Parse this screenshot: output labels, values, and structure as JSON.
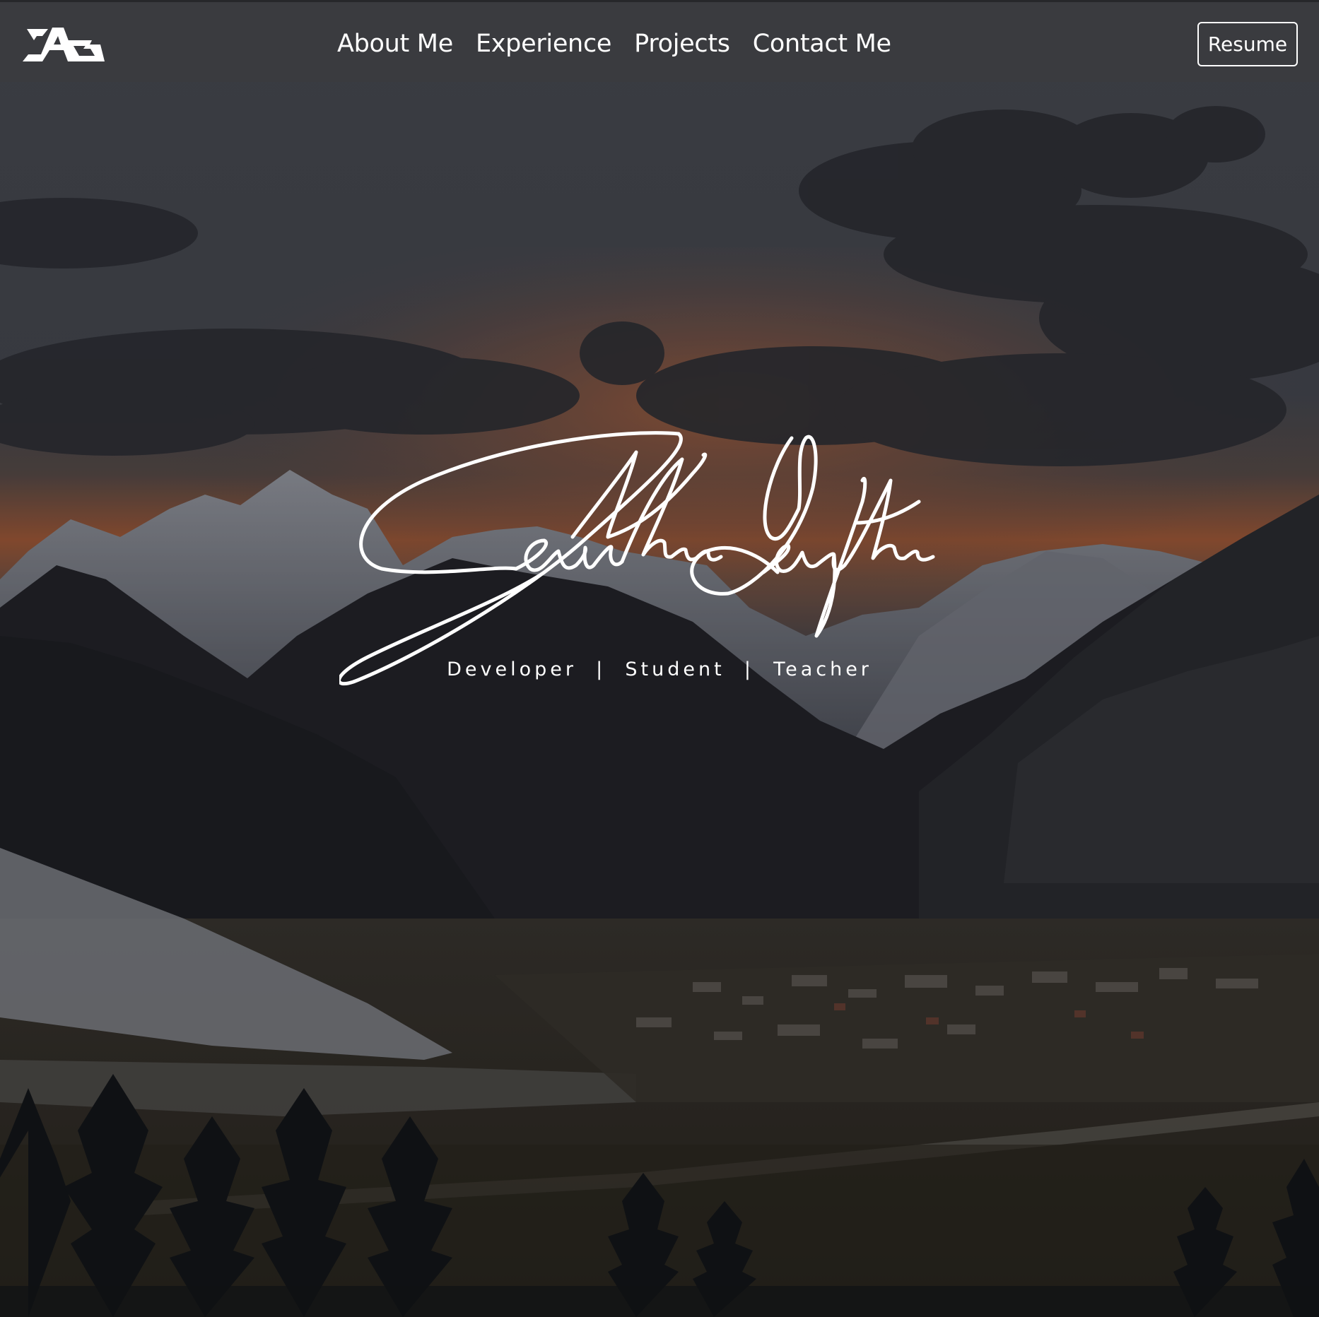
{
  "navbar": {
    "brand": {
      "logo_text": "AG",
      "icon": "ag-monogram-logo"
    },
    "links": [
      {
        "label": "About Me"
      },
      {
        "label": "Experience"
      },
      {
        "label": "Projects"
      },
      {
        "label": "Contact Me"
      }
    ],
    "resume_label": "Resume"
  },
  "hero": {
    "background": "mountain-valley-sunset-photo",
    "signature_text": "Jonathan Gaytan",
    "signature_icon": "handwritten-signature",
    "tagline_parts": [
      "Developer",
      "Student",
      "Teacher"
    ],
    "tagline_separator": "|"
  },
  "colors": {
    "navbar_bg": "#3a3b3f",
    "text": "#ffffff",
    "sunset_orange": "#c8653a",
    "sky_overlay": "#4d5058"
  }
}
